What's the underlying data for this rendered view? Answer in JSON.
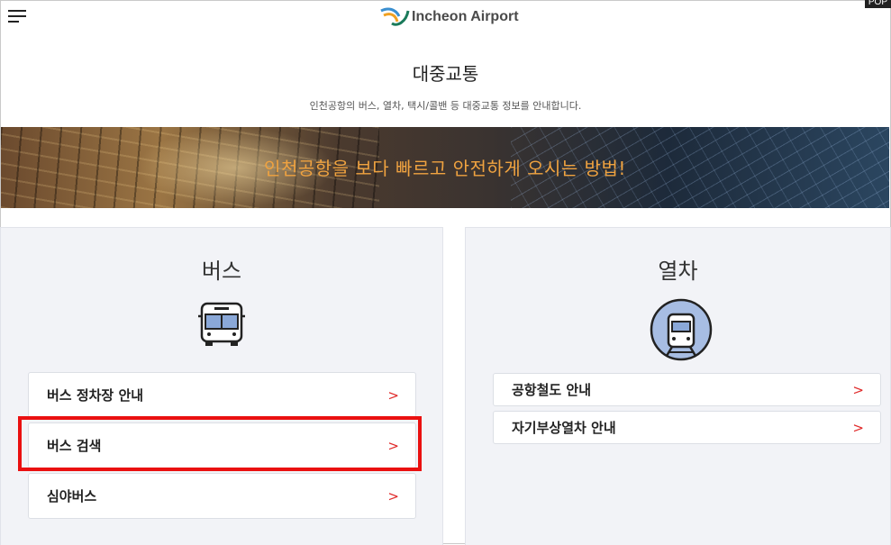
{
  "header": {
    "logo_text": "Incheon Airport",
    "pop_tag": "POP"
  },
  "page": {
    "title": "대중교통",
    "subtitle": "인천공항의 버스, 열차, 택시/콜밴 등 대중교통 정보를 안내합니다."
  },
  "banner": {
    "text": "인천공항을 보다 빠르고 안전하게 오시는 방법!"
  },
  "bus": {
    "title": "버스",
    "icon": "bus-icon",
    "items": [
      {
        "label": "버스 정차장 안내",
        "chevron": ">"
      },
      {
        "label": "버스 검색",
        "chevron": ">"
      },
      {
        "label": "심야버스",
        "chevron": ">"
      }
    ]
  },
  "train": {
    "title": "열차",
    "icon": "train-icon",
    "items": [
      {
        "label": "공항철도 안내",
        "chevron": ">"
      },
      {
        "label": "자기부상열차 안내",
        "chevron": ">"
      }
    ]
  },
  "colors": {
    "accent": "#e02a2a",
    "banner_text": "#f0a340",
    "panel_bg": "#f2f3f7",
    "highlight": "#ea1010"
  }
}
